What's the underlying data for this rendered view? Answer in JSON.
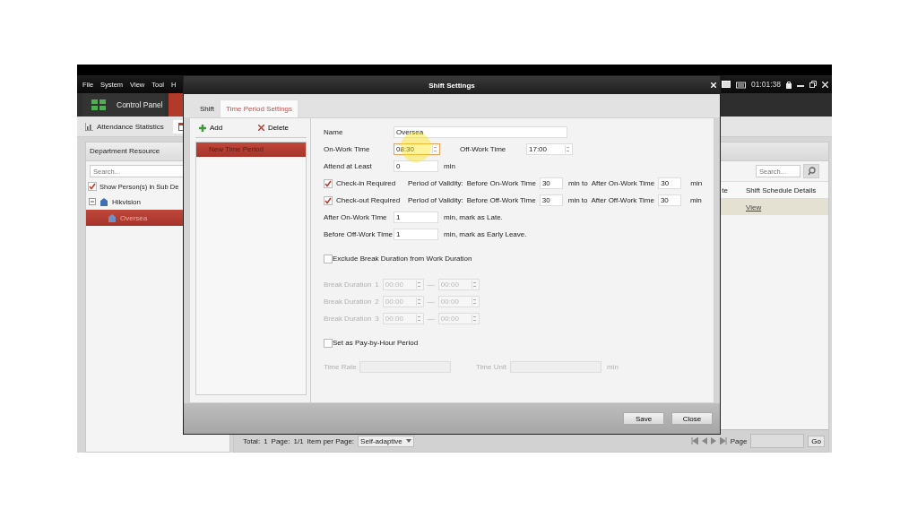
{
  "app": {
    "menu": [
      "File",
      "System",
      "View",
      "Tool",
      "H"
    ],
    "clock": "01:01:38",
    "nav_tabs": [
      {
        "label": "Control Panel",
        "selected": false
      },
      {
        "selected": true
      }
    ],
    "sub_tabs": [
      {
        "label": "Attendance Statistics",
        "kind": "chart",
        "selected": false
      },
      {
        "kind": "calendar",
        "selected": true
      }
    ],
    "department_panel": {
      "title": "Department Resource",
      "search_placeholder": "Search...",
      "show_sub": {
        "label": "Show Person(s) in Sub De",
        "checked": true
      },
      "tree": [
        {
          "label": "Hikvision",
          "expanded": true,
          "selected": false,
          "children": [
            {
              "label": "Oversea",
              "selected": true
            }
          ]
        }
      ]
    },
    "table": {
      "search_placeholder": "Search...",
      "columns": [
        "te",
        "Shift Schedule Details"
      ],
      "rows": [
        {
          "link": "View",
          "selected": true
        }
      ]
    },
    "pager": {
      "total_label": "Total:",
      "total": "1",
      "page_label": "Page:",
      "page": "1/1",
      "per_page_label": "Item per Page:",
      "per_page": "Self-adaptive",
      "goto_label": "Page",
      "go": "Go"
    }
  },
  "dialog": {
    "title": "Shift Settings",
    "tabs": [
      {
        "label": "Shift",
        "selected": false
      },
      {
        "label": "Time Period Settings",
        "selected": true
      }
    ],
    "toolbar": [
      {
        "label": "Add",
        "kind": "add"
      },
      {
        "label": "Delete",
        "kind": "delete"
      }
    ],
    "periods": [
      {
        "label": "New Time Period",
        "selected": true
      }
    ],
    "form": {
      "name": {
        "label": "Name",
        "value": "Oversea"
      },
      "on_work": {
        "label": "On-Work Time",
        "value": "08:30"
      },
      "off_work": {
        "label": "Off-Work Time",
        "value": "17:00"
      },
      "attend": {
        "label": "Attend at Least",
        "value": "0",
        "unit": "min"
      },
      "checks": [
        {
          "label": "Check-in Required",
          "checked": true,
          "validity": "Period of Validity:",
          "before_label": "Before On-Work Time",
          "before": "30",
          "to": "min  to",
          "after_label": "After On-Work Time",
          "after": "30",
          "unit": "min"
        },
        {
          "label": "Check-out Required",
          "checked": true,
          "validity": "Period of Validity:",
          "before_label": "Before Off-Work Time",
          "before": "30",
          "to": "min  to",
          "after_label": "After Off-Work Time",
          "after": "30",
          "unit": "min"
        }
      ],
      "late": {
        "label": "After On-Work Time",
        "value": "1",
        "note": "min,  mark as Late."
      },
      "early": {
        "label": "Before Off-Work Time",
        "value": "1",
        "note": "min,  mark as Early Leave."
      },
      "exclude_break": {
        "label": "Exclude Break Duration from Work Duration",
        "checked": false
      },
      "breaks": [
        {
          "label": "Break Duration",
          "index": "1",
          "start": "00:00",
          "separator": "—",
          "end": "00:00"
        },
        {
          "label": "Break Duration",
          "index": "2",
          "start": "00:00",
          "separator": "—",
          "end": "00:00"
        },
        {
          "label": "Break Duration",
          "index": "3",
          "start": "00:00",
          "separator": "—",
          "end": "00:00"
        }
      ],
      "pay_by_hour": {
        "label": "Set as Pay-by-Hour Period",
        "checked": false
      },
      "time_rate": {
        "label": "Time Rate"
      },
      "time_unit": {
        "label": "Time Unit",
        "unit": "min"
      }
    },
    "buttons": [
      "Save",
      "Close"
    ]
  }
}
